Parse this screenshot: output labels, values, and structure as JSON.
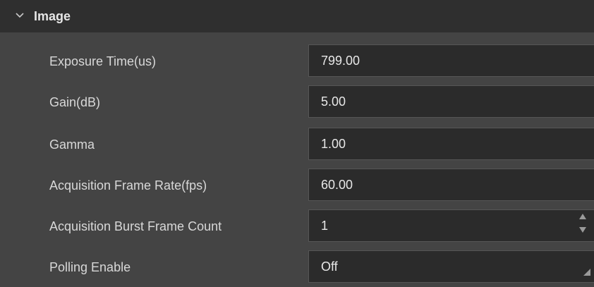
{
  "section": {
    "title": "Image",
    "icon": "chevron-down-icon"
  },
  "rows": [
    {
      "label": "Exposure Time(us)",
      "value": "799.00"
    },
    {
      "label": "Gain(dB)",
      "value": "5.00"
    },
    {
      "label": "Gamma",
      "value": "1.00"
    },
    {
      "label": "Acquisition Frame Rate(fps)",
      "value": "60.00"
    },
    {
      "label": "Acquisition Burst Frame Count",
      "value": "1"
    },
    {
      "label": "Polling Enable",
      "value": "Off"
    }
  ],
  "icons": {
    "spin_up": "spin-up-icon",
    "spin_down": "spin-down-icon",
    "dropdown": "dropdown-corner-icon"
  },
  "colors": {
    "panel_bg": "#444444",
    "header_bg": "#2f2f2f",
    "field_bg": "#2b2b2b",
    "text": "#d8d8d8"
  }
}
